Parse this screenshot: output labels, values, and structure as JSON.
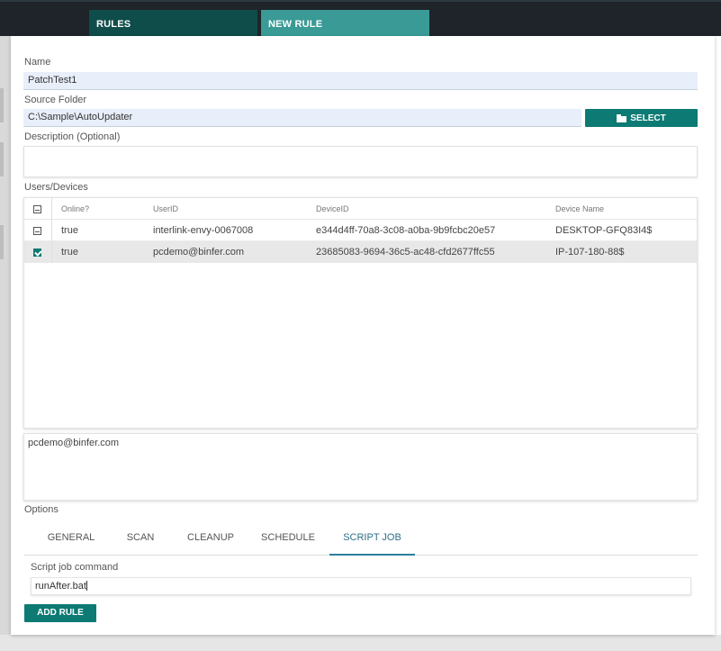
{
  "nav": {
    "tabs": [
      {
        "label": "RULES"
      },
      {
        "label": "NEW RULE"
      }
    ]
  },
  "form": {
    "name_label": "Name",
    "name_value": "PatchTest1",
    "source_label": "Source Folder",
    "source_value": "C:\\Sample\\AutoUpdater",
    "select_label": "SELECT",
    "select_icon": "folder-icon",
    "description_label": "Description (Optional)",
    "description_value": ""
  },
  "devices": {
    "section_label": "Users/Devices",
    "columns": [
      "Online?",
      "UserID",
      "DeviceID",
      "Device Name"
    ],
    "rows": [
      {
        "selected": false,
        "online": "true",
        "user": "interlink-envy-0067008",
        "device_id": "e344d4ff-70a8-3c08-a0ba-9b9fcbc20e57",
        "device_name": "DESKTOP-GFQ83I4$"
      },
      {
        "selected": true,
        "online": "true",
        "user": "pcdemo@binfer.com",
        "device_id": "23685083-9694-36c5-ac48-cfd2677ffc55",
        "device_name": "IP-107-180-88$"
      }
    ],
    "selected_summary": "pcdemo@binfer.com"
  },
  "options": {
    "label": "Options",
    "tabs": [
      "GENERAL",
      "SCAN",
      "CLEANUP",
      "SCHEDULE",
      "SCRIPT JOB"
    ],
    "active_tab": "SCRIPT JOB",
    "script_label": "Script job command",
    "script_value": "runAfter.bat"
  },
  "actions": {
    "add_rule_label": "ADD RULE"
  },
  "colors": {
    "accent": "#0d7a74",
    "nav_dark": "#0f4d4a",
    "nav_light": "#3a9a96",
    "topbar": "#1e2429"
  }
}
